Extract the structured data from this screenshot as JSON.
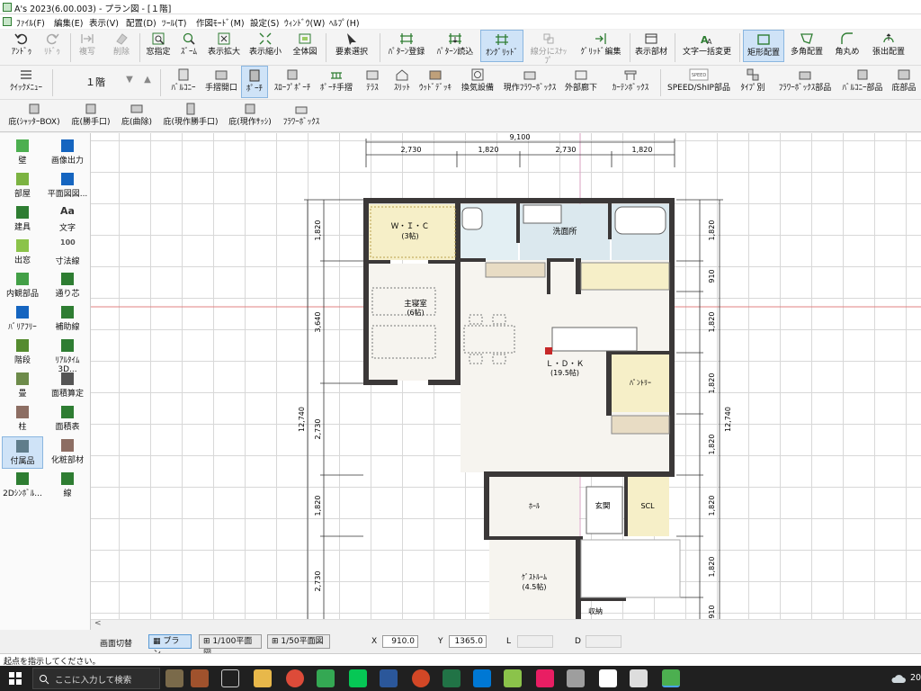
{
  "window": {
    "title": "A's 2023(6.00.003) - プラン図 - [１階]"
  },
  "menu": [
    "ﾌｧｲﾙ(F)",
    "編集(E)",
    "表示(V)",
    "配置(D)",
    "ﾂｰﾙ(T)",
    "作図ﾓｰﾄﾞ(M)",
    "設定(S)",
    "ｳｨﾝﾄﾞｳ(W)",
    "ﾍﾙﾌﾟ(H)"
  ],
  "toolbar1": [
    {
      "label": "ｱﾝﾄﾞｩ",
      "icon": "undo-icon"
    },
    {
      "label": "ﾘﾄﾞｩ",
      "icon": "redo-icon",
      "disabled": true
    },
    {
      "label": "複写",
      "icon": "copy-icon",
      "disabled": true
    },
    {
      "label": "削除",
      "icon": "eraser-icon",
      "disabled": true
    },
    {
      "label": "窓指定",
      "icon": "window-select-icon"
    },
    {
      "label": "ｽﾞｰﾑ",
      "icon": "zoom-icon"
    },
    {
      "label": "表示拡大",
      "icon": "expand-icon"
    },
    {
      "label": "表示縮小",
      "icon": "shrink-icon"
    },
    {
      "label": "全体図",
      "icon": "fit-icon"
    },
    {
      "label": "要素選択",
      "icon": "cursor-icon"
    },
    {
      "label": "ﾊﾟﾀｰﾝ登録",
      "icon": "pattern-save-icon"
    },
    {
      "label": "ﾊﾟﾀｰﾝ読込",
      "icon": "pattern-load-icon"
    },
    {
      "label": "ｵﾝｸﾞﾘｯﾄﾞ",
      "icon": "grid-on-icon",
      "active": true
    },
    {
      "label": "線分にｽﾅｯﾌﾟ",
      "icon": "snap-icon",
      "disabled": true
    },
    {
      "label": "ｸﾞﾘｯﾄﾞ編集",
      "icon": "grid-edit-icon"
    },
    {
      "label": "表示部材",
      "icon": "parts-icon"
    },
    {
      "label": "文字一括変更",
      "icon": "text-replace-icon"
    },
    {
      "label": "矩形配置",
      "icon": "rect-icon",
      "active": true
    },
    {
      "label": "多角配置",
      "icon": "polygon-icon"
    },
    {
      "label": "角丸め",
      "icon": "round-corner-icon"
    },
    {
      "label": "張出配置",
      "icon": "extrude-icon"
    }
  ],
  "toolbar2": {
    "quick_label": "ｸｲｯｸﾒﾆｭｰ",
    "floor": "１階",
    "items": [
      {
        "label": "ﾊﾞﾙｺﾆｰ"
      },
      {
        "label": "手摺開口"
      },
      {
        "label": "ﾎﾟｰﾁ",
        "active": true
      },
      {
        "label": "ｽﾛｰﾌﾟﾎﾟｰﾁ"
      },
      {
        "label": "ﾎﾟｰﾁ手摺"
      },
      {
        "label": "ﾃﾗｽ"
      },
      {
        "label": "ｽﾘｯﾄ"
      },
      {
        "label": "ｳｯﾄﾞﾃﾞｯｷ"
      },
      {
        "label": "換気設備"
      },
      {
        "label": "現作ﾌﾗﾜｰﾎﾞｯｸｽ"
      },
      {
        "label": "外部廊下"
      },
      {
        "label": "ｶｰﾃﾝﾎﾞｯｸｽ"
      },
      {
        "label": "SPEED/ShIP部品"
      },
      {
        "label": "ﾀｲﾌﾟ別"
      },
      {
        "label": "ﾌﾗﾜｰﾎﾞｯｸｽ部品"
      },
      {
        "label": "ﾊﾞﾙｺﾆｰ部品"
      },
      {
        "label": "庇部品"
      }
    ],
    "speed_icon_text": "SPEED"
  },
  "toolbar3": [
    {
      "label": "庇(ｼｬｯﾀｰBOX)"
    },
    {
      "label": "庇(勝手口)"
    },
    {
      "label": "庇(曲除)"
    },
    {
      "label": "庇(現作勝手口)"
    },
    {
      "label": "庇(現作ｻｯｼ)"
    },
    {
      "label": "ﾌﾗﾜｰﾎﾞｯｸｽ"
    }
  ],
  "sidebar": [
    {
      "label": "壁",
      "icon": "wall-icon"
    },
    {
      "label": "画像出力",
      "icon": "image-export-icon"
    },
    {
      "label": "部屋",
      "icon": "room-icon"
    },
    {
      "label": "平面図図...",
      "icon": "plan-icon"
    },
    {
      "label": "建具",
      "icon": "door-icon"
    },
    {
      "label": "文字",
      "icon": "text-icon",
      "glyph": "Aa"
    },
    {
      "label": "出窓",
      "icon": "bay-window-icon"
    },
    {
      "label": "寸法線",
      "icon": "dimension-icon",
      "glyph": "100"
    },
    {
      "label": "内観部品",
      "icon": "interior-icon"
    },
    {
      "label": "通り芯",
      "icon": "axis-icon"
    },
    {
      "label": "ﾊﾞﾘｱﾌﾘｰ",
      "icon": "barrier-free-icon"
    },
    {
      "label": "補助線",
      "icon": "aux-line-icon"
    },
    {
      "label": "階段",
      "icon": "stairs-icon"
    },
    {
      "label": "ﾘｱﾙﾀｲﾑ3D...",
      "icon": "realtime-3d-icon"
    },
    {
      "label": "畳",
      "icon": "tatami-icon"
    },
    {
      "label": "面積算定",
      "icon": "area-calc-icon"
    },
    {
      "label": "柱",
      "icon": "column-icon"
    },
    {
      "label": "面積表",
      "icon": "area-table-icon"
    },
    {
      "label": "付属品",
      "icon": "accessory-icon",
      "active": true
    },
    {
      "label": "化粧部材",
      "icon": "trim-icon"
    },
    {
      "label": "2Dｼﾝﾎﾞﾙ...",
      "icon": "symbol-2d-icon"
    },
    {
      "label": "線",
      "icon": "line-icon"
    }
  ],
  "dimensions": {
    "top_total": "9,100",
    "top": [
      "2,730",
      "1,820",
      "2,730",
      "1,820"
    ],
    "left": [
      "1,820",
      "3,640",
      "2,730",
      "1,820",
      "2,730"
    ],
    "left_total": "12,740",
    "right": [
      "1,820",
      "910",
      "1,820",
      "1,820",
      "1,820",
      "1,820",
      "1,820",
      "910"
    ],
    "right_total": "12,740"
  },
  "rooms": {
    "wic": "Ｗ・Ｉ・Ｃ",
    "wic_size": "(3帖)",
    "wash": "洗面所",
    "master": "主寝室",
    "master_size": "(6帖)",
    "ldk": "Ｌ・Ｄ・Ｋ",
    "ldk_size": "(19.5帖)",
    "pantry": "ﾊﾟﾝﾄﾘｰ",
    "hall": "ﾎｰﾙ",
    "entrance": "玄関",
    "scl": "SCL",
    "guest": "ｹﾞｽﾄﾙｰﾑ",
    "guest_size": "(4.5帖)",
    "storage": "収納"
  },
  "status": {
    "switch_label": "画面切替",
    "plan": "プラン",
    "scale100": "1/100平面図",
    "scale50": "1/50平面図",
    "x_label": "X",
    "x_value": "910.0",
    "y_label": "Y",
    "y_value": "1365.0",
    "l_label": "L",
    "d_label": "D",
    "hint": "起点を指示してください。"
  },
  "taskbar": {
    "search_placeholder": "ここに入力して検索",
    "clock": "20"
  },
  "colors": {
    "accent": "#0078d7",
    "active_bg": "#cfe3f7",
    "wall": "#3b3838",
    "wic_fill": "#f6efc8",
    "wash_fill": "#dbe8ee"
  }
}
